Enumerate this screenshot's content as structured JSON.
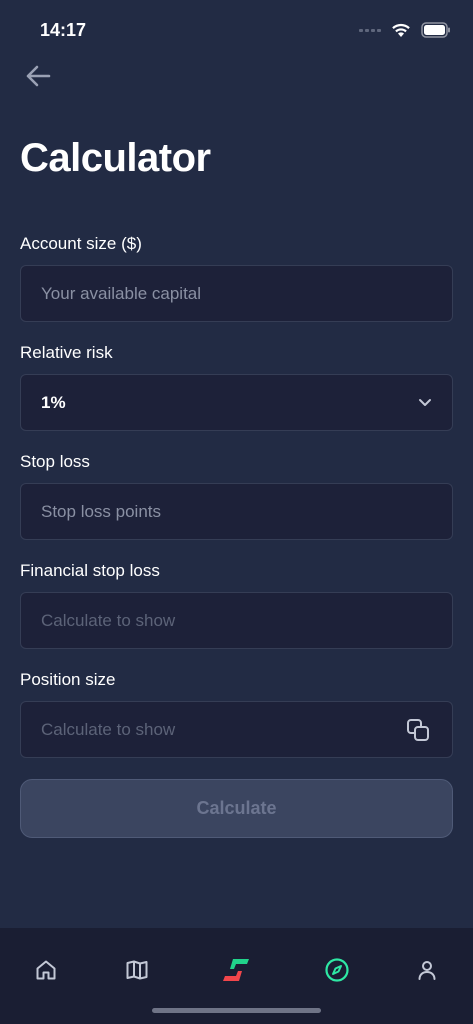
{
  "status": {
    "time": "14:17"
  },
  "page": {
    "title": "Calculator"
  },
  "form": {
    "account_size": {
      "label": "Account size ($)",
      "placeholder": "Your available capital"
    },
    "relative_risk": {
      "label": "Relative risk",
      "value": "1%"
    },
    "stop_loss": {
      "label": "Stop loss",
      "placeholder": "Stop loss points"
    },
    "financial_stop_loss": {
      "label": "Financial stop loss",
      "placeholder": "Calculate to show"
    },
    "position_size": {
      "label": "Position size",
      "placeholder": "Calculate to show"
    }
  },
  "actions": {
    "calculate_label": "Calculate"
  },
  "tab_bar": {
    "items": [
      {
        "icon": "home-icon"
      },
      {
        "icon": "book-icon"
      },
      {
        "icon": "logo-icon"
      },
      {
        "icon": "compass-icon",
        "active": true
      },
      {
        "icon": "profile-icon"
      }
    ]
  },
  "colors": {
    "background": "#222b44",
    "field_background": "#1d2139",
    "accent": "#2ee8a4",
    "logo_red": "#f2464b",
    "logo_green": "#21d38b"
  }
}
